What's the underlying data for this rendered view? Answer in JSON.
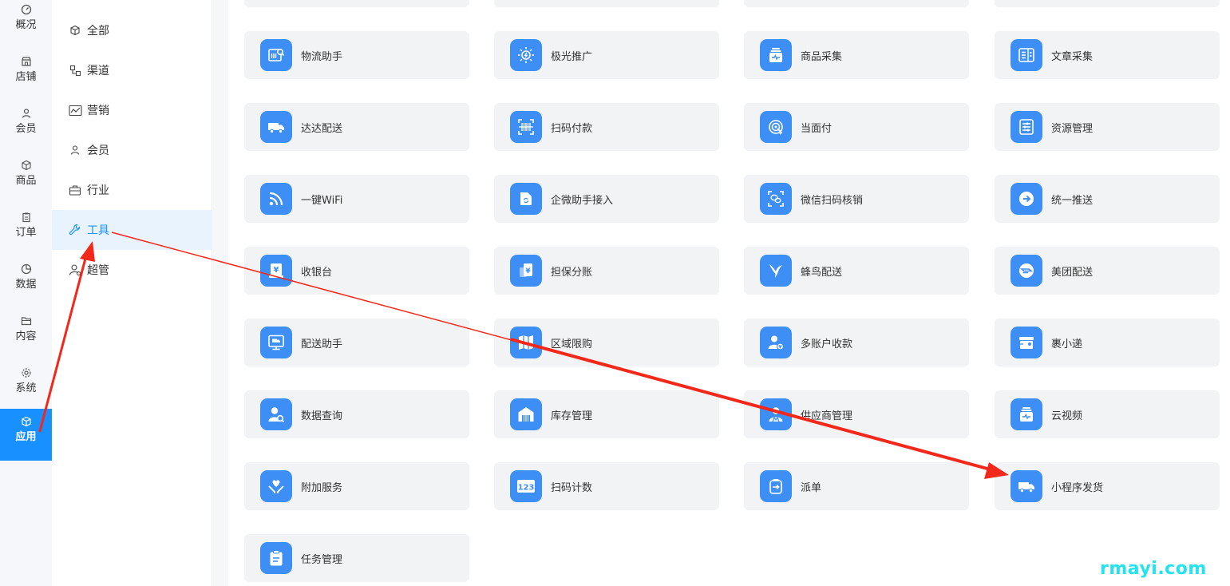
{
  "rail": {
    "items": [
      {
        "label": "概况",
        "icon": "dashboard-icon"
      },
      {
        "label": "店铺",
        "icon": "store-icon"
      },
      {
        "label": "会员",
        "icon": "user-icon"
      },
      {
        "label": "商品",
        "icon": "box-icon"
      },
      {
        "label": "订单",
        "icon": "clipboard-icon"
      },
      {
        "label": "数据",
        "icon": "pie-chart-icon"
      },
      {
        "label": "内容",
        "icon": "folder-icon"
      },
      {
        "label": "系统",
        "icon": "gear-icon"
      },
      {
        "label": "应用",
        "icon": "cube-icon",
        "active": true
      }
    ]
  },
  "submenu": {
    "items": [
      {
        "label": "全部",
        "icon": "cube-icon"
      },
      {
        "label": "渠道",
        "icon": "channel-icon"
      },
      {
        "label": "营销",
        "icon": "trend-icon"
      },
      {
        "label": "会员",
        "icon": "user-icon"
      },
      {
        "label": "行业",
        "icon": "briefcase-icon"
      },
      {
        "label": "工具",
        "icon": "wrench-icon",
        "active": true
      },
      {
        "label": "超管",
        "icon": "admin-icon"
      }
    ]
  },
  "cards": [
    {
      "label": "物流助手",
      "icon": "logistics-icon"
    },
    {
      "label": "极光推广",
      "icon": "aurora-icon"
    },
    {
      "label": "商品采集",
      "icon": "collect-icon"
    },
    {
      "label": "文章采集",
      "icon": "article-icon"
    },
    {
      "label": "达达配送",
      "icon": "truck-icon"
    },
    {
      "label": "扫码付款",
      "icon": "barcode-icon"
    },
    {
      "label": "当面付",
      "icon": "face-pay-icon"
    },
    {
      "label": "资源管理",
      "icon": "resource-icon"
    },
    {
      "label": "一键WiFi",
      "icon": "wifi-icon"
    },
    {
      "label": "企微助手接入",
      "icon": "wecom-icon"
    },
    {
      "label": "微信扫码核销",
      "icon": "wechat-scan-icon"
    },
    {
      "label": "统一推送",
      "icon": "push-icon"
    },
    {
      "label": "收银台",
      "icon": "cashier-icon"
    },
    {
      "label": "担保分账",
      "icon": "split-icon"
    },
    {
      "label": "蜂鸟配送",
      "icon": "hummingbird-icon"
    },
    {
      "label": "美团配送",
      "icon": "meituan-icon"
    },
    {
      "label": "配送助手",
      "icon": "delivery-monitor-icon"
    },
    {
      "label": "区域限购",
      "icon": "map-icon"
    },
    {
      "label": "多账户收款",
      "icon": "multi-account-icon"
    },
    {
      "label": "裹小递",
      "icon": "parcel-icon"
    },
    {
      "label": "数据查询",
      "icon": "user-search-icon"
    },
    {
      "label": "库存管理",
      "icon": "warehouse-icon"
    },
    {
      "label": "供应商管理",
      "icon": "supplier-icon"
    },
    {
      "label": "云视频",
      "icon": "video-icon"
    },
    {
      "label": "附加服务",
      "icon": "hand-heart-icon"
    },
    {
      "label": "扫码计数",
      "icon": "counter-icon"
    },
    {
      "label": "派单",
      "icon": "dispatch-icon"
    },
    {
      "label": "小程序发货",
      "icon": "ship-icon"
    },
    {
      "label": "任务管理",
      "icon": "task-icon"
    }
  ],
  "watermark": "rmayi.com",
  "colors": {
    "accent": "#1890ff",
    "card_icon": "#3d8ff5",
    "card_bg": "#f2f3f5",
    "annotation": "#f2281a",
    "watermark": "#22e3ee"
  }
}
